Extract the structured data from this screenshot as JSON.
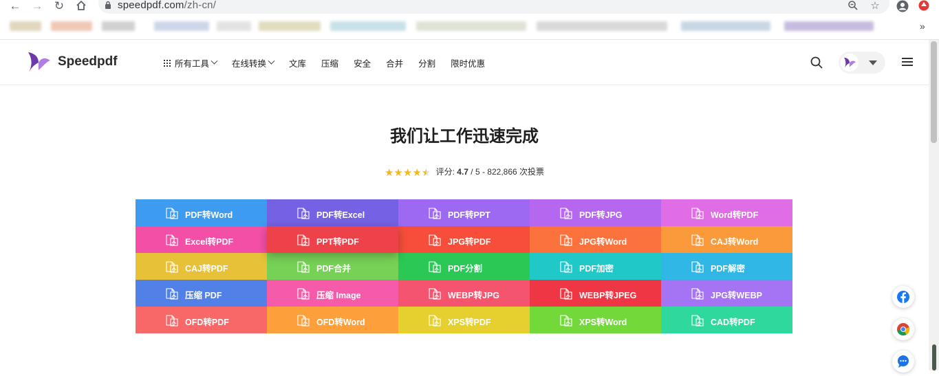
{
  "browser": {
    "url_host": "speedpdf.com",
    "url_path": "/zh-cn/",
    "overflow": "»"
  },
  "header": {
    "brand": "Speedpdf",
    "nav": [
      {
        "label": "所有工具",
        "dropdown": true,
        "grid": true
      },
      {
        "label": "在线转换",
        "dropdown": true
      },
      {
        "label": "文库"
      },
      {
        "label": "压缩"
      },
      {
        "label": "安全"
      },
      {
        "label": "合并"
      },
      {
        "label": "分割"
      },
      {
        "label": "限时优惠"
      }
    ]
  },
  "hero": {
    "title": "我们让工作迅速完成",
    "rating_prefix": "评分:",
    "rating_value": "4.7",
    "rating_suffix": "/ 5 - 822,866 次投票",
    "stars": 4.5
  },
  "tools": [
    {
      "label": "PDF转Word",
      "color": "#3d9bf0",
      "icon": "pdf-word-icon"
    },
    {
      "label": "PDF转Excel",
      "color": "#7561e3",
      "icon": "pdf-excel-icon"
    },
    {
      "label": "PDF转PPT",
      "color": "#9d69f3",
      "icon": "pdf-ppt-icon"
    },
    {
      "label": "PDF转JPG",
      "color": "#b667ef",
      "icon": "pdf-jpg-icon"
    },
    {
      "label": "Word转PDF",
      "color": "#e06ce6",
      "icon": "word-pdf-icon"
    },
    {
      "label": "Excel转PDF",
      "color": "#f44fa6",
      "icon": "excel-pdf-icon"
    },
    {
      "label": "PPT转PDF",
      "color": "#ee424b",
      "icon": "ppt-pdf-icon",
      "hovered": true
    },
    {
      "label": "JPG转PDF",
      "color": "#f74e3b",
      "icon": "jpg-pdf-icon"
    },
    {
      "label": "JPG转Word",
      "color": "#fb723c",
      "icon": "jpg-word-icon"
    },
    {
      "label": "CAJ转Word",
      "color": "#fb9a3a",
      "icon": "caj-word-icon"
    },
    {
      "label": "CAJ转PDF",
      "color": "#e7c239",
      "icon": "caj-pdf-icon"
    },
    {
      "label": "PDF合并",
      "color": "#77d156",
      "icon": "merge-icon"
    },
    {
      "label": "PDF分割",
      "color": "#2bc856",
      "icon": "split-icon"
    },
    {
      "label": "PDF加密",
      "color": "#20c8c7",
      "icon": "lock-icon"
    },
    {
      "label": "PDF解密",
      "color": "#30b7e6",
      "icon": "unlock-icon"
    },
    {
      "label": "压缩 PDF",
      "color": "#5181e7",
      "icon": "compress-pdf-icon"
    },
    {
      "label": "压缩 Image",
      "color": "#f55ba9",
      "icon": "compress-image-icon"
    },
    {
      "label": "WEBP转JPG",
      "color": "#f5546e",
      "icon": "webp-jpg-icon"
    },
    {
      "label": "WEBP转JPEG",
      "color": "#ee3644",
      "icon": "webp-jpeg-icon"
    },
    {
      "label": "JPG转WEBP",
      "color": "#a474f4",
      "icon": "jpg-webp-icon"
    },
    {
      "label": "OFD转PDF",
      "color": "#f86868",
      "icon": "ofd-pdf-icon"
    },
    {
      "label": "OFD转Word",
      "color": "#fd9f3b",
      "icon": "ofd-word-icon"
    },
    {
      "label": "XPS转PDF",
      "color": "#e5d030",
      "icon": "xps-pdf-icon"
    },
    {
      "label": "XPS转Word",
      "color": "#73d93b",
      "icon": "xps-word-icon"
    },
    {
      "label": "CAD转PDF",
      "color": "#2fd99d",
      "icon": "cad-pdf-icon"
    }
  ],
  "floating": [
    {
      "icon": "facebook-icon"
    },
    {
      "icon": "chrome-icon"
    },
    {
      "icon": "chat-icon"
    }
  ]
}
